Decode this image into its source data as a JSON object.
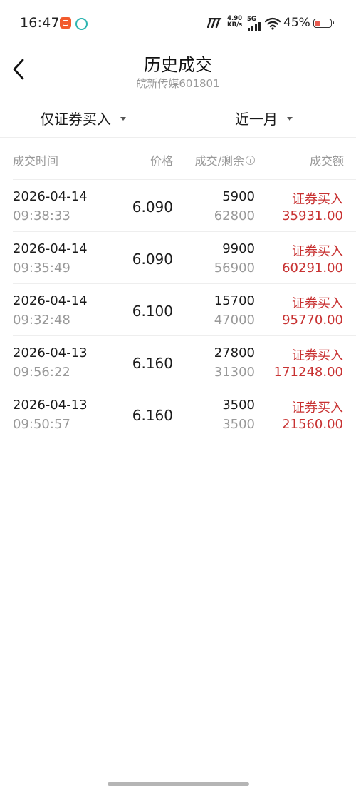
{
  "status_bar": {
    "time": "16:47",
    "net_speed_value": "4.90",
    "net_speed_unit": "KB/s",
    "network_type": "5G",
    "battery_percent": "45%",
    "battery_level": 0.4,
    "icons": [
      "app-badge-icon",
      "hd-icon",
      "network-logo-icon",
      "signal-icon",
      "wifi-icon",
      "battery-icon"
    ]
  },
  "header": {
    "title": "历史成交",
    "subtitle": "皖新传媒601801",
    "back_icon": "chevron-left-icon"
  },
  "filters": {
    "type": "仅证券买入",
    "period": "近一月"
  },
  "table": {
    "headers": {
      "time": "成交时间",
      "price": "价格",
      "volume_remaining": "成交/剩余",
      "amount": "成交额"
    },
    "rows": [
      {
        "date": "2026-04-14",
        "time": "09:38:33",
        "price": "6.090",
        "volume": "5900",
        "remaining": "62800",
        "type": "证券买入",
        "amount": "35931.00"
      },
      {
        "date": "2026-04-14",
        "time": "09:35:49",
        "price": "6.090",
        "volume": "9900",
        "remaining": "56900",
        "type": "证券买入",
        "amount": "60291.00"
      },
      {
        "date": "2026-04-14",
        "time": "09:32:48",
        "price": "6.100",
        "volume": "15700",
        "remaining": "47000",
        "type": "证券买入",
        "amount": "95770.00"
      },
      {
        "date": "2026-04-13",
        "time": "09:56:22",
        "price": "6.160",
        "volume": "27800",
        "remaining": "31300",
        "type": "证券买入",
        "amount": "171248.00"
      },
      {
        "date": "2026-04-13",
        "time": "09:50:57",
        "price": "6.160",
        "volume": "3500",
        "remaining": "3500",
        "type": "证券买入",
        "amount": "21560.00"
      }
    ]
  },
  "colors": {
    "buy_red": "#c83232",
    "muted_gray": "#999999"
  }
}
